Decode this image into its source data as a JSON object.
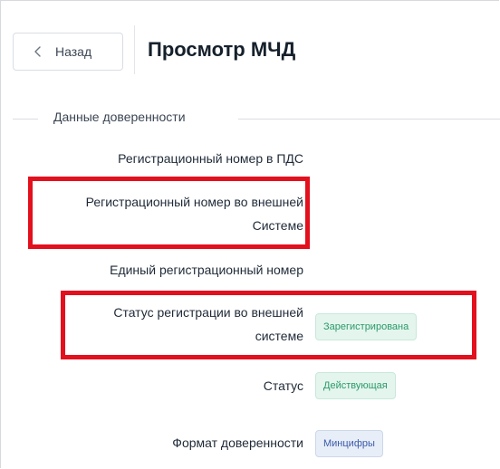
{
  "header": {
    "back_label": "Назад",
    "title": "Просмотр МЧД"
  },
  "section": {
    "title": "Данные доверенности"
  },
  "fields": {
    "reg_number_pds": {
      "label": "Регистрационный номер в ПДС"
    },
    "reg_number_external": {
      "label_line1": "Регистрационный номер во внешней",
      "label_line2": "Системе"
    },
    "unified_reg_number": {
      "label": "Единый регистрационный номер"
    },
    "external_reg_status": {
      "label_line1": "Статус регистрации во внешней",
      "label_line2": "системе",
      "value": "Зарегистрирована"
    },
    "status": {
      "label": "Статус",
      "value": "Действующая"
    },
    "format": {
      "label": "Формат доверенности",
      "value": "Минцифры"
    }
  },
  "colors": {
    "highlight": "#e3101e",
    "badge_green_text": "#2a9a68",
    "badge_blue_text": "#3b5ba8"
  },
  "icons": {
    "back": "chevron-left-icon"
  }
}
